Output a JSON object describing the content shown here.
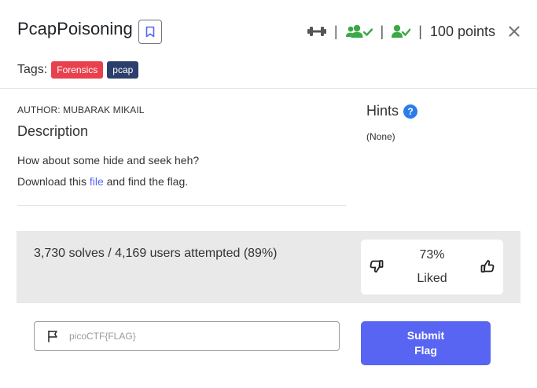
{
  "challenge": {
    "title": "PcapPoisoning",
    "points": "100 points",
    "separator": "|"
  },
  "tags": {
    "label": "Tags:",
    "items": [
      {
        "name": "Forensics",
        "color": "#e8414d"
      },
      {
        "name": "pcap",
        "color": "#2c3e6b"
      }
    ]
  },
  "description": {
    "author": "AUTHOR: MUBARAK MIKAIL",
    "heading": "Description",
    "line1": "How about some hide and seek heh?",
    "line2_prefix": "Download this ",
    "line2_link": "file",
    "line2_suffix": " and find the flag."
  },
  "hints": {
    "heading": "Hints",
    "help_glyph": "?",
    "content": "(None)"
  },
  "stats": {
    "summary": "3,730 solves / 4,169 users attempted (89%)",
    "liked_percent": "73%",
    "liked_label": "Liked"
  },
  "flag_form": {
    "placeholder": "picoCTF{FLAG}",
    "value": "",
    "submit_label": "Submit Flag"
  },
  "icons": {
    "bookmark": "bookmark-icon",
    "difficulty": "dumbbell-icon",
    "solvers": "users-check-icon",
    "solved": "user-check-icon",
    "close": "close-icon",
    "hint": "question-circle-icon",
    "dislike": "thumbs-down-icon",
    "like": "thumbs-up-icon",
    "flag": "flag-icon"
  },
  "colors": {
    "accent": "#5865f2",
    "link": "#5a67f0",
    "solved_green": "#3aa845",
    "stats_bg": "#e9e9e9"
  }
}
